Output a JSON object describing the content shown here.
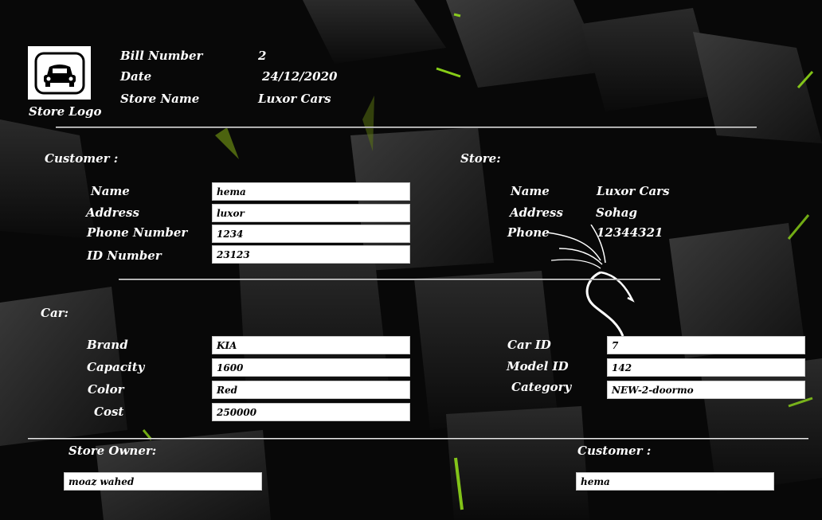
{
  "header": {
    "bill_number_label": "Bill Number",
    "bill_number_value": "2",
    "date_label": "Date",
    "date_value": "24/12/2020",
    "store_name_label": "Store Name",
    "store_name_value": "Luxor Cars",
    "logo_caption": "Store Logo",
    "logo_icon": "car-icon"
  },
  "customer": {
    "section_title": "Customer :",
    "name_label": "Name",
    "name_value": "hema",
    "address_label": "Address",
    "address_value": "luxor",
    "phone_label": "Phone Number",
    "phone_value": "1234",
    "id_label": "ID Number",
    "id_value": "23123"
  },
  "store": {
    "section_title": "Store:",
    "name_label": "Name",
    "name_value": "Luxor Cars",
    "address_label": "Address",
    "address_value": "Sohag",
    "phone_label": "Phone",
    "phone_value": "12344321"
  },
  "car": {
    "section_title": "Car:",
    "brand_label": "Brand",
    "brand_value": "KIA",
    "capacity_label": "Capacity",
    "capacity_value": "1600",
    "color_label": "Color",
    "color_value": "Red",
    "cost_label": "Cost",
    "cost_value": "250000",
    "car_id_label": "Car ID",
    "car_id_value": "7",
    "model_id_label": "Model ID",
    "model_id_value": "142",
    "category_label": "Category",
    "category_value": "NEW-2-doormo"
  },
  "signatures": {
    "owner_label": "Store Owner:",
    "owner_value": "moaz wahed",
    "customer_label": "Customer :",
    "customer_value": "hema"
  },
  "colors": {
    "background": "#050505",
    "accent": "#9ef01a",
    "field_bg": "#ffffff"
  }
}
